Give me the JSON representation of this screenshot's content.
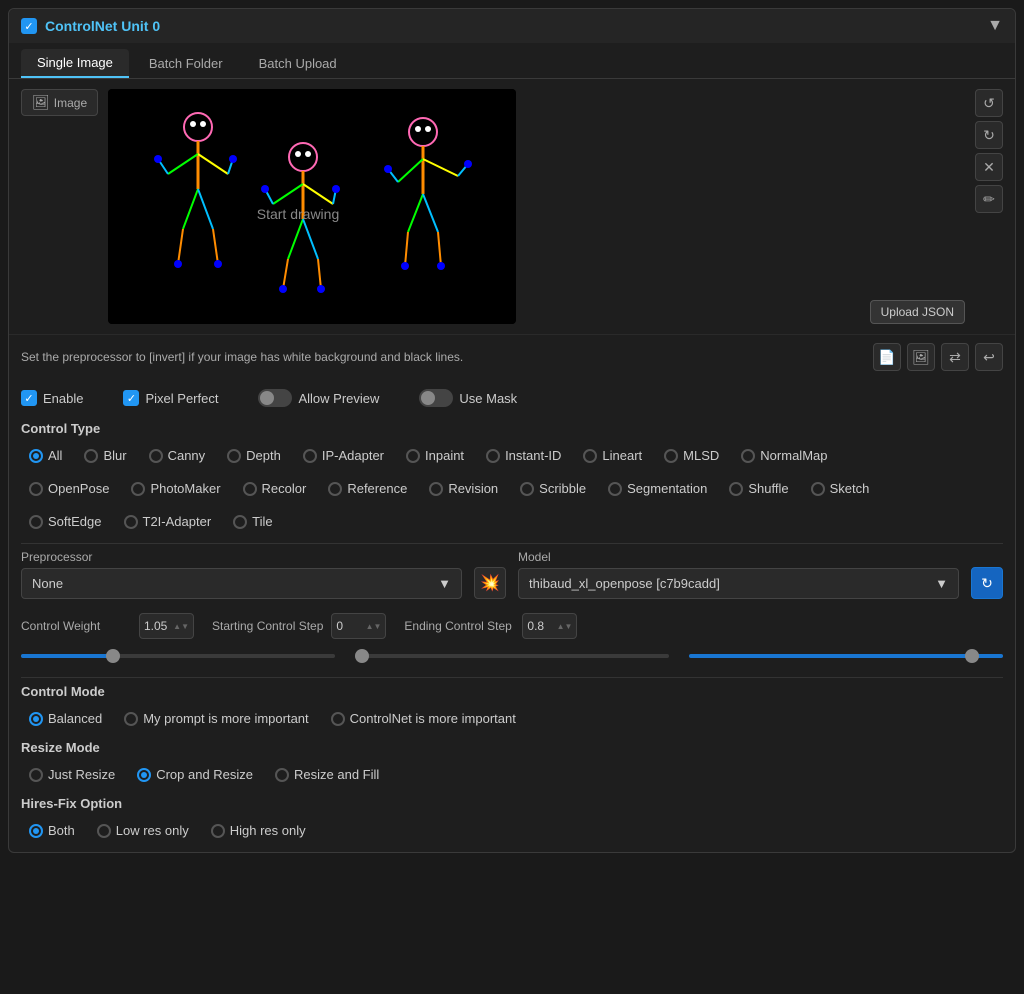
{
  "panel": {
    "title": "ControlNet Unit 0",
    "enabled_checkbox": true,
    "dropdown_label": "▼"
  },
  "tabs": {
    "items": [
      {
        "label": "Single Image",
        "active": true
      },
      {
        "label": "Batch Folder",
        "active": false
      },
      {
        "label": "Batch Upload",
        "active": false
      }
    ]
  },
  "image": {
    "label": "Image",
    "start_drawing": "Start drawing",
    "upload_json": "Upload JSON"
  },
  "info_bar": {
    "text": "Set the preprocessor to [invert] if your image has white background and black lines."
  },
  "checkboxes": {
    "enable": {
      "label": "Enable",
      "checked": true
    },
    "pixel_perfect": {
      "label": "Pixel Perfect",
      "checked": true
    },
    "allow_preview": {
      "label": "Allow Preview",
      "checked": false
    },
    "use_mask": {
      "label": "Use Mask",
      "checked": false
    }
  },
  "control_type": {
    "label": "Control Type",
    "options": [
      {
        "label": "All",
        "selected": true
      },
      {
        "label": "Blur",
        "selected": false
      },
      {
        "label": "Canny",
        "selected": false
      },
      {
        "label": "Depth",
        "selected": false
      },
      {
        "label": "IP-Adapter",
        "selected": false
      },
      {
        "label": "Inpaint",
        "selected": false
      },
      {
        "label": "Instant-ID",
        "selected": false
      },
      {
        "label": "Lineart",
        "selected": false
      },
      {
        "label": "MLSD",
        "selected": false
      },
      {
        "label": "NormalMap",
        "selected": false
      },
      {
        "label": "OpenPose",
        "selected": false
      },
      {
        "label": "PhotoMaker",
        "selected": false
      },
      {
        "label": "Recolor",
        "selected": false
      },
      {
        "label": "Reference",
        "selected": false
      },
      {
        "label": "Revision",
        "selected": false
      },
      {
        "label": "Scribble",
        "selected": false
      },
      {
        "label": "Segmentation",
        "selected": false
      },
      {
        "label": "Shuffle",
        "selected": false
      },
      {
        "label": "Sketch",
        "selected": false
      },
      {
        "label": "SoftEdge",
        "selected": false
      },
      {
        "label": "T2I-Adapter",
        "selected": false
      },
      {
        "label": "Tile",
        "selected": false
      }
    ]
  },
  "preprocessor": {
    "label": "Preprocessor",
    "value": "None"
  },
  "model": {
    "label": "Model",
    "value": "thibaud_xl_openpose [c7b9cadd]"
  },
  "control_weight": {
    "label": "Control Weight",
    "value": "1.05",
    "fill_pct": 28
  },
  "starting_step": {
    "label": "Starting Control Step",
    "value": "0",
    "fill_pct": 0
  },
  "ending_step": {
    "label": "Ending Control Step",
    "value": "0.8",
    "fill_pct": 88
  },
  "control_mode": {
    "label": "Control Mode",
    "options": [
      {
        "label": "Balanced",
        "selected": true
      },
      {
        "label": "My prompt is more important",
        "selected": false
      },
      {
        "label": "ControlNet is more important",
        "selected": false
      }
    ]
  },
  "resize_mode": {
    "label": "Resize Mode",
    "options": [
      {
        "label": "Just Resize",
        "selected": false
      },
      {
        "label": "Crop and Resize",
        "selected": true
      },
      {
        "label": "Resize and Fill",
        "selected": false
      }
    ]
  },
  "hires_fix": {
    "label": "Hires-Fix Option",
    "options": [
      {
        "label": "Both",
        "selected": true
      },
      {
        "label": "Low res only",
        "selected": false
      },
      {
        "label": "High res only",
        "selected": false
      }
    ]
  }
}
